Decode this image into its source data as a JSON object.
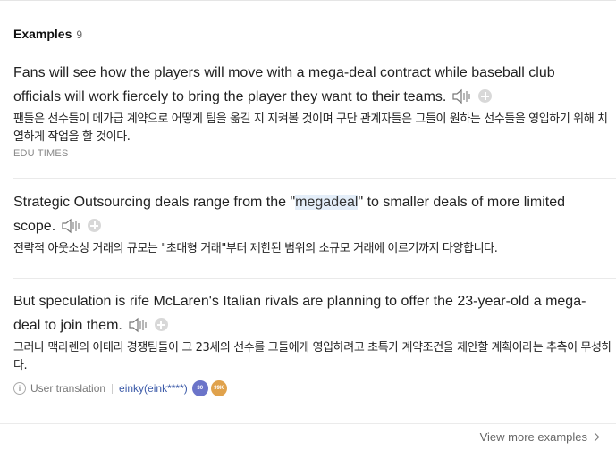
{
  "header": {
    "title": "Examples",
    "count": "9"
  },
  "examples": [
    {
      "en_before": "Fans will see how the players will move with a mega-deal contract while baseball club officials will work fiercely to bring the player they want to their teams.",
      "ko": "팬들은 선수들이 메가급 계약으로 어떻게 팀을 옮길 지 지켜볼 것이며 구단 관계자들은 그들이 원하는 선수들을 영입하기 위해 치열하게 작업을 할 것이다.",
      "source": "EDU TIMES"
    },
    {
      "en_before": "Strategic Outsourcing deals range from the \"",
      "en_highlight": "megadeal",
      "en_after": "\" to smaller deals of more limited scope.",
      "ko": "전략적 아웃소싱 거래의 규모는 \"초대형 거래\"부터 제한된 범위의 소규모 거래에 이르기까지 다양합니다."
    },
    {
      "en_before": "But speculation is rife McLaren's Italian rivals are planning to offer the 23-year-old a mega-deal to join them.",
      "ko": "그러나 맥라렌의 이태리 경쟁팀들이 그 23세의 선수를 그들에게 영입하려고 초특가 계약조건을 제안할 계획이라는 추측이 무성하다.",
      "meta": {
        "label": "User translation",
        "user": "einky(eink****)",
        "badge_a": "30",
        "badge_b": "99K"
      }
    }
  ],
  "footer": {
    "view_more": "View more examples"
  },
  "icons": {
    "speaker": "speaker-icon",
    "add": "plus-circle-icon",
    "info": "info-icon",
    "chevron": "chevron-right-icon"
  }
}
